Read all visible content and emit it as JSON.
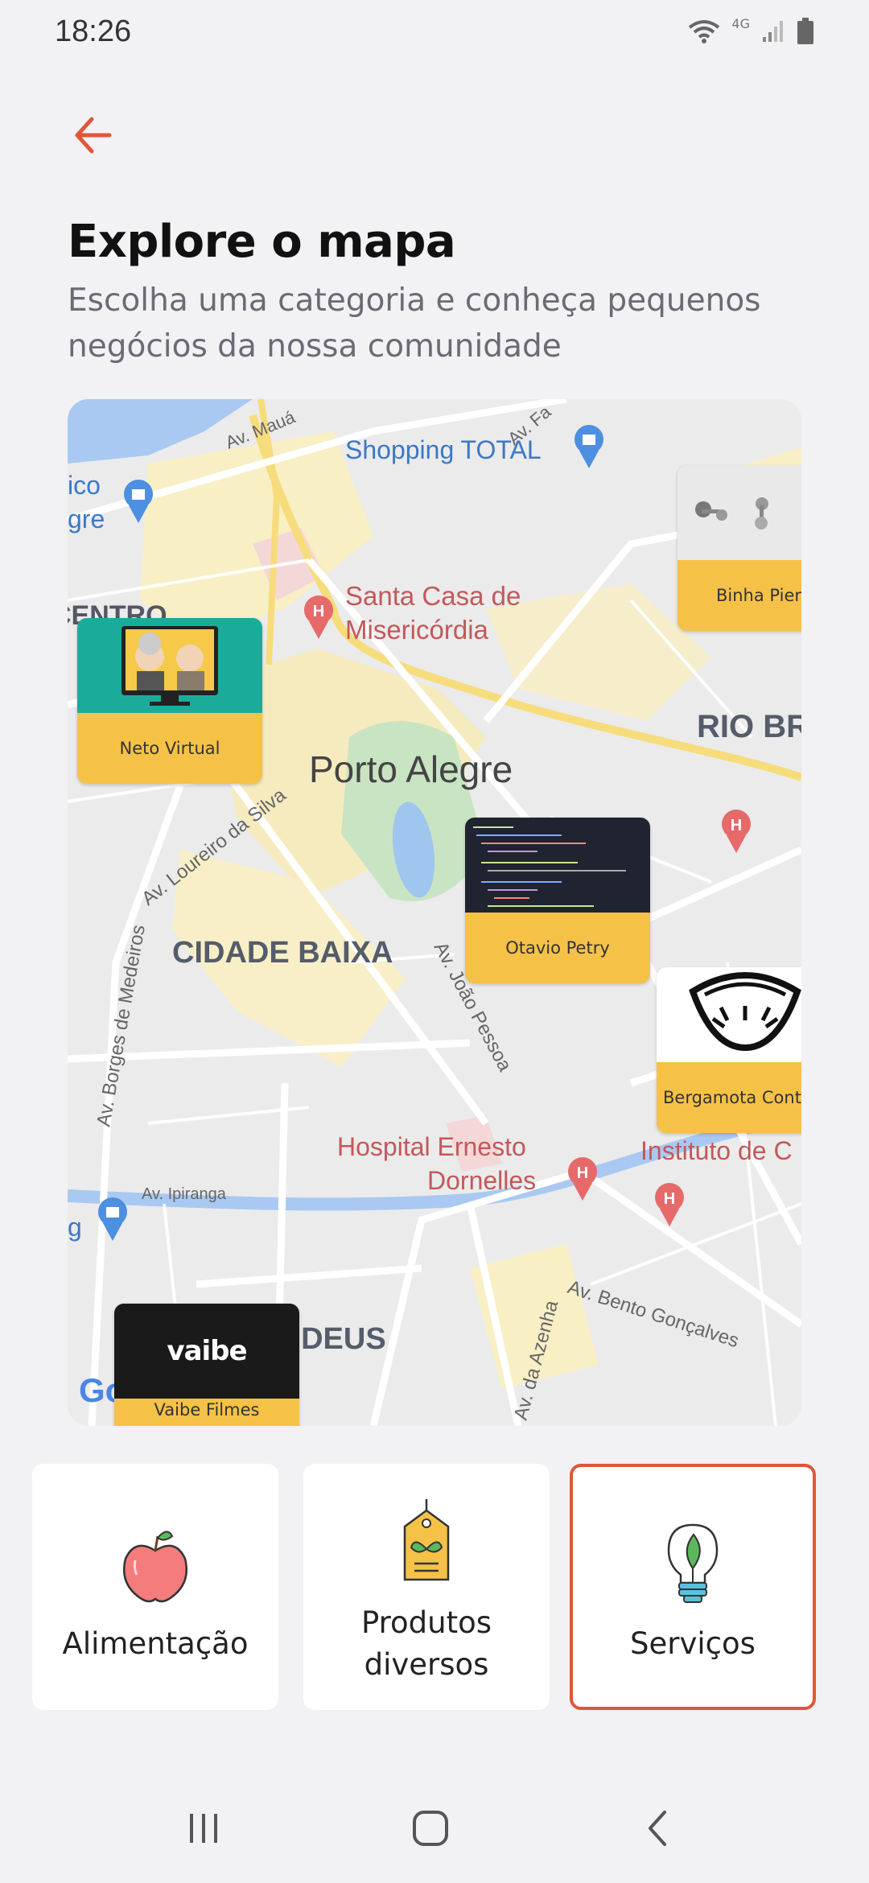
{
  "status": {
    "time": "18:26",
    "network": "4G",
    "icons": [
      "wifi-icon",
      "signal-icon",
      "battery-icon"
    ]
  },
  "header": {
    "back_icon": "arrow-left-icon",
    "title": "Explore o mapa",
    "subtitle": "Escolha uma categoria e conheça pequenos negócios da nossa comunidade"
  },
  "map": {
    "labels": {
      "av_maua": "Av. Mauá",
      "av_fa": "Av. Fa",
      "shopping": "Shopping TOTAL",
      "ico": "ico",
      "gre": "gre",
      "centro": "CENTRO",
      "santa_casa_1": "Santa Casa de",
      "santa_casa_2": "Misericórdia",
      "rio_br": "RIO BR",
      "porto_alegre": "Porto Alegre",
      "loureiro": "Av. Loureiro da Silva",
      "cidade_baixa": "CIDADE BAIXA",
      "joao_pessoa": "Av. João Pessoa",
      "borges": "Av. Borges de Medeiros",
      "hospital_1": "Hospital Ernesto",
      "hospital_2": "Dornelles",
      "instituto": "Instituto de C",
      "ipiranga": "Av. Ipiranga",
      "g": "g",
      "deus": "O DEUS",
      "bento": "Av. Bento Gonçalves",
      "azenha": "Av. da Azenha",
      "google": "Google"
    },
    "businesses": [
      {
        "name": "Neto Virtual"
      },
      {
        "name": "Binha Piercing"
      },
      {
        "name": "Otavio Petry"
      },
      {
        "name": "Bergamota Conteúdo"
      },
      {
        "name": "Vaibe Filmes"
      }
    ],
    "logo_text": "vaibe"
  },
  "categories": [
    {
      "label": "Alimentação",
      "icon": "apple-icon",
      "selected": false
    },
    {
      "label": "Produtos diversos",
      "label_line1": "Produtos",
      "label_line2": "diversos",
      "icon": "tag-leaf-icon",
      "selected": false
    },
    {
      "label": "Serviços",
      "icon": "lightbulb-leaf-icon",
      "selected": true
    }
  ],
  "colors": {
    "accent": "#e0563a",
    "card_label_bg": "#f5c247",
    "subtitle": "#6b6b76",
    "background": "#f2f2f4"
  },
  "navbar": {
    "icons": [
      "recent-apps-icon",
      "home-icon",
      "back-nav-icon"
    ]
  }
}
